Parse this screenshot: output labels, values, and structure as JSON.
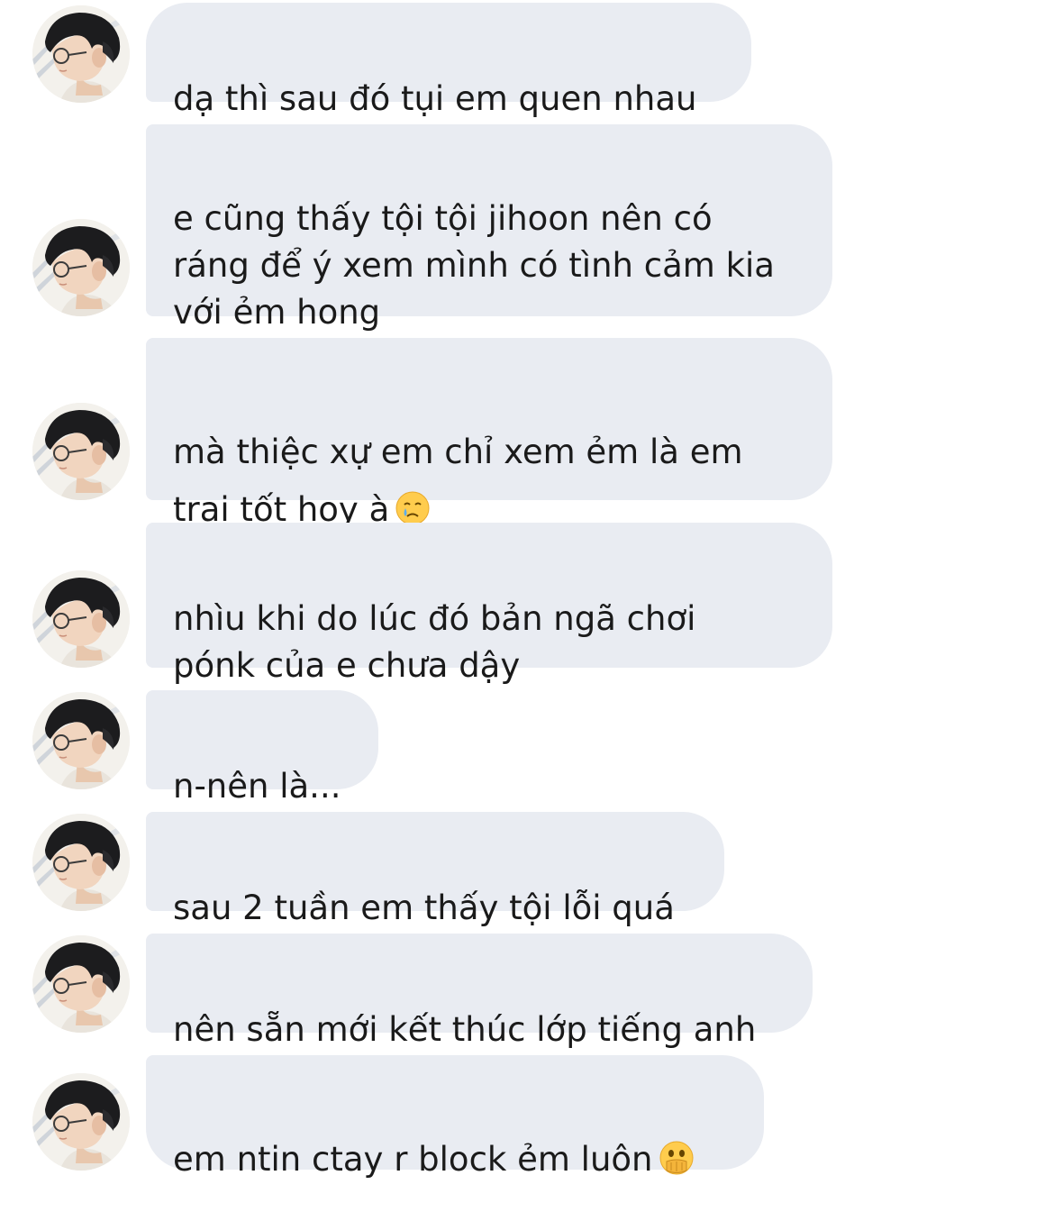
{
  "messages": [
    {
      "text": "dạ thì sau đó tụi em quen nhau",
      "emoji": ""
    },
    {
      "text": "e cũng thấy tội tội jihoon nên có\nráng để ý xem mình có tình cảm kia\nvới ẻm hong",
      "emoji": ""
    },
    {
      "text": "mà thiệc xự em chỉ xem ẻm là em\ntrai tốt hoy à",
      "emoji": "crying-face-emoji"
    },
    {
      "text": "nhìu khi do lúc đó bản ngã chơi\npónk của e chưa dậy",
      "emoji": ""
    },
    {
      "text": "n-nên là...",
      "emoji": ""
    },
    {
      "text": "sau 2 tuần em thấy tội lỗi quá",
      "emoji": ""
    },
    {
      "text": "nên sẵn mới kết thúc lớp tiếng anh",
      "emoji": ""
    },
    {
      "text": "em ntin ctay r block ẻm luôn",
      "emoji": "face-with-open-eyes-and-hand-over-mouth-emoji"
    }
  ],
  "colors": {
    "bubble": "#e9ecf2",
    "text": "#1a1a1a",
    "background": "#ffffff",
    "emoji_yellow": "#ffcc4d"
  }
}
